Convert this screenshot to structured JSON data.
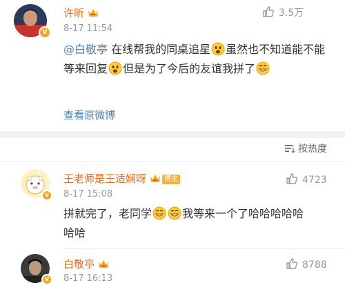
{
  "comment1": {
    "author": "许昕",
    "time": "8-17 11:54",
    "likes": "3.5万",
    "mention": "@白敬亭",
    "text_a": " 在线帮我的同桌追星",
    "text_b": "虽然也不知道能不能等来回复",
    "text_c": "但是为了今后的友谊我拼了",
    "view_original": "查看原微博"
  },
  "sort_label": "按热度",
  "reply1": {
    "author": "王老师是王适娴呀",
    "badge": "博主",
    "time": "8-17 15:08",
    "likes": "4723",
    "text_a": "拼就完了，老同学",
    "text_b": "我等来一个了哈哈哈哈哈",
    "text_c": "哈哈"
  },
  "reply2": {
    "author": "白敬亭",
    "time": "8-17 16:13",
    "likes": "8788"
  },
  "colors": {
    "name_orange": "#e86c1f",
    "link_blue": "#507daf",
    "badge_gold": "#f6a623"
  },
  "icons": [
    "thumbs-up-icon",
    "crown-icon",
    "verified-badge-icon",
    "sort-icon",
    "emoji-face-icon"
  ]
}
